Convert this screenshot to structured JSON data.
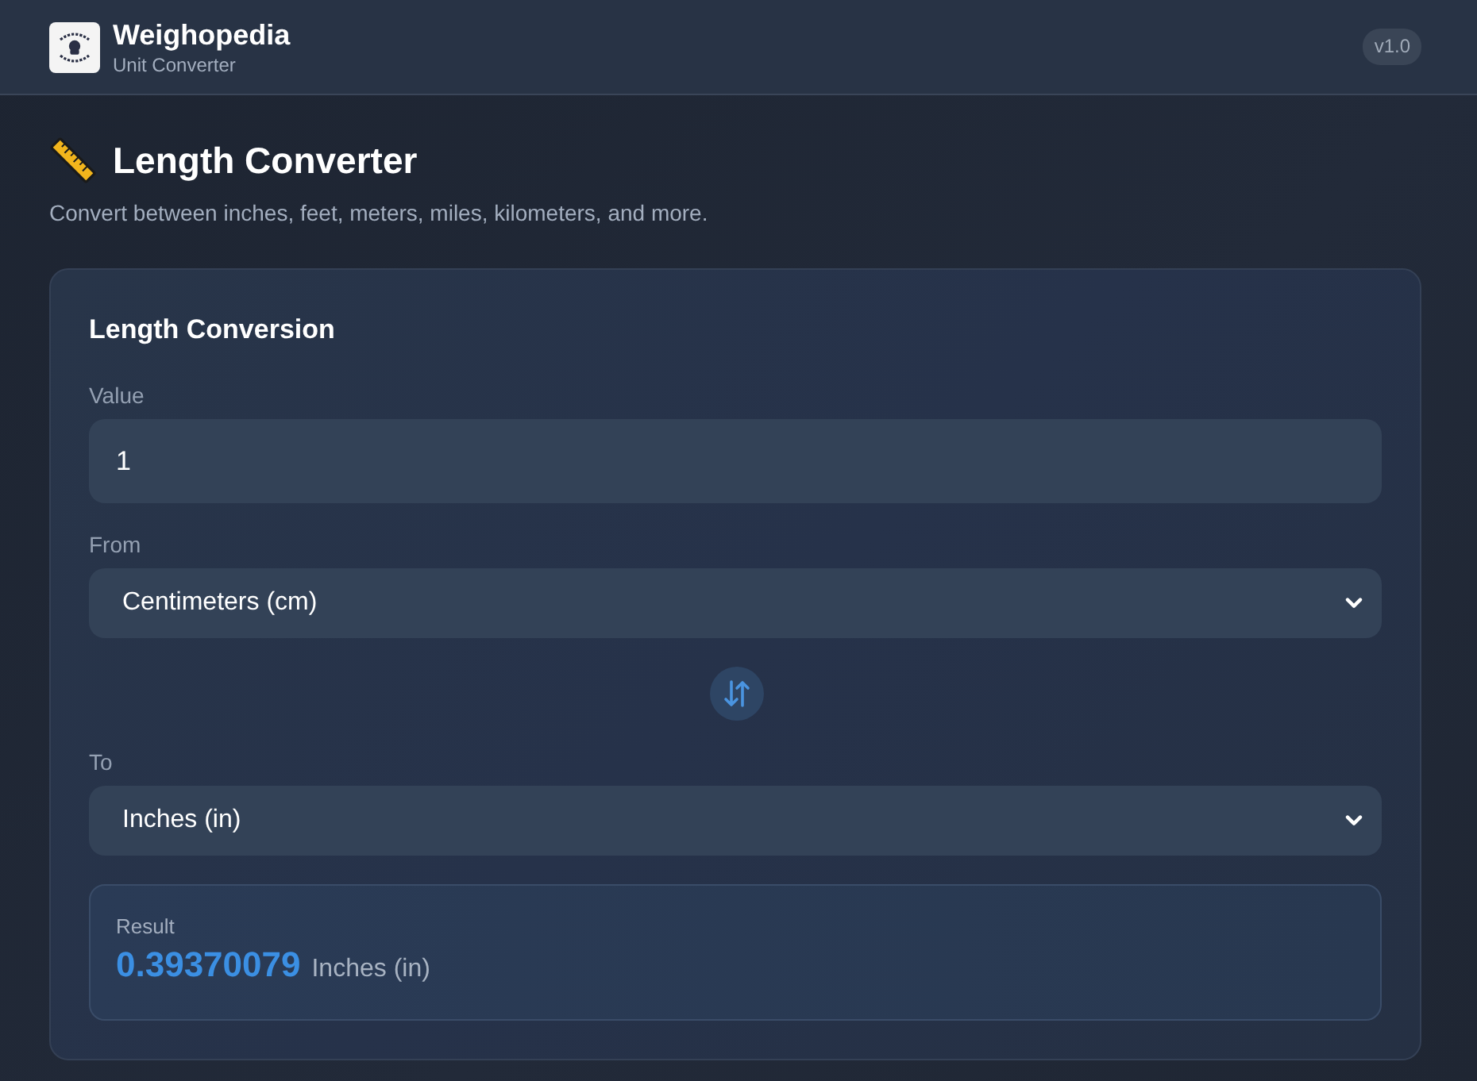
{
  "header": {
    "app_name": "Weighopedia",
    "subtitle": "Unit Converter",
    "version": "v1.0"
  },
  "page": {
    "title": "Length Converter",
    "description": "Convert between inches, feet, meters, miles, kilometers, and more."
  },
  "converter": {
    "title": "Length Conversion",
    "fields": [
      {
        "kind": "input",
        "label": "Value",
        "value": "1"
      },
      {
        "kind": "select",
        "label": "From",
        "value": "Centimeters (cm)"
      },
      {
        "kind": "swap"
      },
      {
        "kind": "select",
        "label": "To",
        "value": "Inches (in)"
      }
    ],
    "result": {
      "label": "Result",
      "value": "0.39370079",
      "unit": "Inches (in)"
    }
  }
}
